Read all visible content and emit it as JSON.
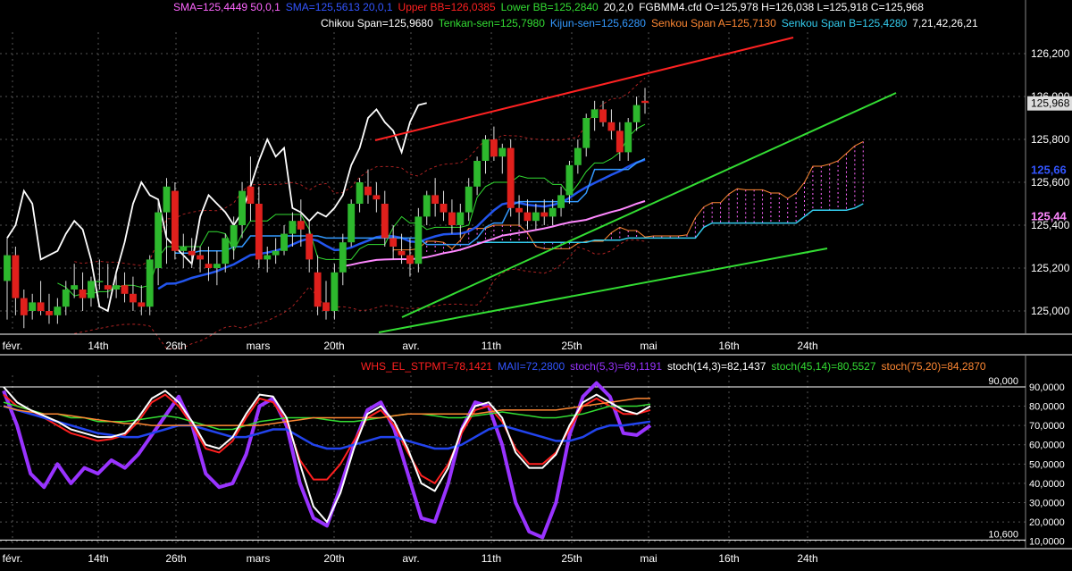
{
  "header": {
    "line1": [
      {
        "text": "SMA=125,4449  50,0,1",
        "color": "#ff66ff"
      },
      {
        "text": "SMA=125,5613  20,0,1",
        "color": "#3355ff"
      },
      {
        "text": "Upper BB=126,0385",
        "color": "#ff2020"
      },
      {
        "text": "Lower BB=125,2840",
        "color": "#33dd33"
      },
      {
        "text": "20,2,0",
        "color": "#ffffff"
      },
      {
        "text": "FGBMM4.cfd O=125,978 H=126,038 L=125,918 C=125,968",
        "color": "#ffffff"
      }
    ],
    "line2": [
      {
        "text": "Chikou Span=125,9680",
        "color": "#ffffff"
      },
      {
        "text": "Tenkan-sen=125,7980",
        "color": "#33dd33"
      },
      {
        "text": "Kijun-sen=125,6280",
        "color": "#3399ff"
      },
      {
        "text": "Senkou Span A=125,7130",
        "color": "#ff8833"
      },
      {
        "text": "Senkou Span B=125,4280",
        "color": "#33ccee"
      },
      {
        "text": "7,21,42,26,21",
        "color": "#ffffff"
      }
    ],
    "osc_line": [
      {
        "text": "WHS_EL_STPMT=78,1421",
        "color": "#ff2020"
      },
      {
        "text": "MAII=72,2800",
        "color": "#3355ff"
      },
      {
        "text": "stoch(5,3)=69,1191",
        "color": "#9933ff"
      },
      {
        "text": "stoch(14,3)=82,1437",
        "color": "#ffffff"
      },
      {
        "text": "stoch(45,14)=80,5527",
        "color": "#33dd33"
      },
      {
        "text": "stoch(75,20)=84,2870",
        "color": "#ff8833"
      }
    ]
  },
  "x_ticks": [
    "févr.",
    "14th",
    "26th",
    "mars",
    "20th",
    "avr.",
    "11th",
    "25th",
    "mai",
    "16th",
    "24th"
  ],
  "price_ticks": [
    "126,200",
    "126,000",
    "125,800",
    "125,600",
    "125,400",
    "125,200",
    "125,000"
  ],
  "price_badges": {
    "last": "125,968",
    "kijun": "125,66",
    "sma": "125,44"
  },
  "osc_ticks": [
    "90,0000",
    "80,0000",
    "70,0000",
    "60,0000",
    "50,0000",
    "40,0000",
    "30,0000",
    "20,0000",
    "10,0000"
  ],
  "osc_levels": {
    "upper": "90,000",
    "lower": "10,600"
  },
  "colors": {
    "up": "#2db82d",
    "down": "#e0201c",
    "sma50": "#ff88ff",
    "sma20": "#2255ee",
    "bb": "#ff2020",
    "tenkan": "#33dd33",
    "kijun": "#3399ff",
    "spanA": "#ff8833",
    "spanB": "#33ccee",
    "chikou": "#ffffff"
  },
  "chart_data": [
    {
      "type": "candlestick",
      "title": "FGBMM4.cfd",
      "ylim": [
        124.9,
        126.3
      ],
      "x": [
        "févr.",
        "14th",
        "26th",
        "mars",
        "20th",
        "avr.",
        "11th",
        "25th",
        "mai"
      ],
      "ohlc_approx": [
        [
          125.14,
          125.34,
          124.96,
          125.26
        ],
        [
          125.26,
          125.3,
          124.98,
          125.06
        ],
        [
          125.06,
          125.1,
          124.92,
          124.98
        ],
        [
          125.0,
          125.08,
          124.96,
          125.04
        ],
        [
          125.04,
          125.14,
          124.98,
          125.0
        ],
        [
          125.0,
          125.08,
          124.94,
          124.98
        ],
        [
          124.98,
          125.06,
          124.94,
          125.02
        ],
        [
          125.02,
          125.14,
          124.98,
          125.1
        ],
        [
          125.1,
          125.22,
          125.06,
          125.12
        ],
        [
          125.1,
          125.18,
          125.0,
          125.06
        ],
        [
          125.06,
          125.16,
          125.02,
          125.14
        ],
        [
          125.14,
          125.24,
          125.1,
          125.14
        ],
        [
          125.12,
          125.22,
          125.06,
          125.1
        ],
        [
          125.1,
          125.18,
          125.06,
          125.12
        ],
        [
          125.12,
          125.18,
          125.04,
          125.08
        ],
        [
          125.08,
          125.16,
          125.0,
          125.04
        ],
        [
          125.04,
          125.12,
          124.98,
          125.02
        ],
        [
          125.02,
          125.26,
          124.98,
          125.24
        ],
        [
          125.2,
          125.52,
          125.12,
          125.46
        ],
        [
          125.46,
          125.62,
          125.22,
          125.58
        ],
        [
          125.56,
          125.6,
          125.24,
          125.28
        ],
        [
          125.28,
          125.36,
          125.2,
          125.3
        ],
        [
          125.28,
          125.34,
          125.2,
          125.26
        ],
        [
          125.26,
          125.3,
          125.18,
          125.24
        ],
        [
          125.22,
          125.3,
          125.14,
          125.2
        ],
        [
          125.2,
          125.28,
          125.12,
          125.22
        ],
        [
          125.22,
          125.36,
          125.18,
          125.34
        ],
        [
          125.3,
          125.44,
          125.24,
          125.4
        ],
        [
          125.4,
          125.6,
          125.34,
          125.56
        ],
        [
          125.58,
          125.72,
          125.42,
          125.5
        ],
        [
          125.5,
          125.58,
          125.2,
          125.24
        ],
        [
          125.24,
          125.3,
          125.18,
          125.26
        ],
        [
          125.26,
          125.34,
          125.22,
          125.28
        ],
        [
          125.28,
          125.4,
          125.26,
          125.36
        ],
        [
          125.36,
          125.46,
          125.3,
          125.42
        ],
        [
          125.42,
          125.52,
          125.3,
          125.38
        ],
        [
          125.36,
          125.42,
          125.18,
          125.24
        ],
        [
          125.18,
          125.26,
          124.98,
          125.02
        ],
        [
          125.04,
          125.14,
          124.96,
          125.0
        ],
        [
          125.0,
          125.22,
          124.96,
          125.18
        ],
        [
          125.18,
          125.36,
          125.12,
          125.32
        ],
        [
          125.32,
          125.52,
          125.3,
          125.5
        ],
        [
          125.5,
          125.62,
          125.46,
          125.6
        ],
        [
          125.58,
          125.66,
          125.5,
          125.54
        ],
        [
          125.54,
          125.6,
          125.46,
          125.52
        ],
        [
          125.5,
          125.56,
          125.3,
          125.34
        ],
        [
          125.34,
          125.4,
          125.24,
          125.3
        ],
        [
          125.28,
          125.36,
          125.22,
          125.26
        ],
        [
          125.26,
          125.34,
          125.16,
          125.22
        ],
        [
          125.22,
          125.48,
          125.18,
          125.44
        ],
        [
          125.44,
          125.56,
          125.4,
          125.54
        ],
        [
          125.54,
          125.62,
          125.44,
          125.5
        ],
        [
          125.5,
          125.56,
          125.42,
          125.46
        ],
        [
          125.46,
          125.52,
          125.36,
          125.4
        ],
        [
          125.4,
          125.5,
          125.34,
          125.46
        ],
        [
          125.46,
          125.62,
          125.42,
          125.58
        ],
        [
          125.58,
          125.72,
          125.54,
          125.7
        ],
        [
          125.7,
          125.82,
          125.64,
          125.8
        ],
        [
          125.8,
          125.86,
          125.7,
          125.72
        ],
        [
          125.72,
          125.78,
          125.64,
          125.76
        ],
        [
          125.76,
          125.8,
          125.44,
          125.48
        ],
        [
          125.48,
          125.54,
          125.4,
          125.46
        ],
        [
          125.46,
          125.52,
          125.38,
          125.42
        ],
        [
          125.42,
          125.5,
          125.38,
          125.46
        ],
        [
          125.46,
          125.52,
          125.4,
          125.44
        ],
        [
          125.44,
          125.52,
          125.4,
          125.48
        ],
        [
          125.48,
          125.58,
          125.44,
          125.54
        ],
        [
          125.54,
          125.7,
          125.5,
          125.68
        ],
        [
          125.68,
          125.8,
          125.64,
          125.76
        ],
        [
          125.76,
          125.92,
          125.72,
          125.9
        ],
        [
          125.9,
          125.98,
          125.84,
          125.94
        ],
        [
          125.94,
          125.98,
          125.86,
          125.88
        ],
        [
          125.88,
          125.94,
          125.8,
          125.84
        ],
        [
          125.84,
          125.88,
          125.7,
          125.74
        ],
        [
          125.74,
          125.9,
          125.7,
          125.88
        ],
        [
          125.88,
          126.0,
          125.84,
          125.96
        ],
        [
          125.98,
          126.04,
          125.92,
          125.97
        ]
      ]
    },
    {
      "type": "line",
      "ylim": [
        8,
        96
      ],
      "x": [
        "févr.",
        "14th",
        "26th",
        "mars",
        "20th",
        "avr.",
        "11th",
        "25th",
        "mai"
      ],
      "series": [
        {
          "name": "stoch(5,3)",
          "values": [
            88,
            70,
            45,
            38,
            50,
            40,
            48,
            45,
            52,
            48,
            55,
            65,
            75,
            85,
            70,
            45,
            38,
            40,
            55,
            80,
            84,
            70,
            40,
            22,
            18,
            38,
            60,
            78,
            82,
            68,
            45,
            22,
            20,
            40,
            68,
            82,
            80,
            60,
            30,
            15,
            12,
            30,
            65,
            85,
            92,
            85,
            66,
            65,
            70
          ]
        },
        {
          "name": "stoch(14,3)",
          "values": [
            90,
            82,
            78,
            75,
            72,
            68,
            66,
            64,
            64,
            66,
            74,
            84,
            88,
            82,
            72,
            60,
            58,
            64,
            76,
            86,
            85,
            74,
            50,
            28,
            20,
            35,
            58,
            76,
            80,
            72,
            58,
            40,
            36,
            48,
            68,
            80,
            82,
            74,
            56,
            48,
            48,
            55,
            70,
            82,
            86,
            82,
            78,
            76,
            80
          ]
        },
        {
          "name": "WHS_EL_STPMT",
          "values": [
            86,
            80,
            78,
            74,
            70,
            66,
            64,
            62,
            63,
            65,
            72,
            82,
            86,
            80,
            70,
            58,
            56,
            62,
            74,
            84,
            82,
            72,
            52,
            42,
            42,
            50,
            62,
            74,
            78,
            70,
            56,
            44,
            40,
            50,
            66,
            78,
            80,
            72,
            58,
            50,
            50,
            56,
            68,
            80,
            84,
            80,
            76,
            76,
            78
          ]
        },
        {
          "name": "MAII",
          "values": [
            80,
            78,
            76,
            74,
            72,
            70,
            68,
            66,
            65,
            64,
            64,
            66,
            68,
            70,
            70,
            68,
            66,
            64,
            64,
            66,
            68,
            68,
            64,
            60,
            58,
            58,
            60,
            62,
            64,
            64,
            62,
            60,
            58,
            58,
            60,
            64,
            68,
            70,
            68,
            66,
            64,
            62,
            62,
            64,
            68,
            70,
            70,
            71,
            72
          ]
        },
        {
          "name": "stoch(45,14)",
          "values": [
            82,
            80,
            78,
            76,
            76,
            74,
            74,
            72,
            72,
            72,
            73,
            74,
            75,
            74,
            72,
            70,
            68,
            68,
            70,
            72,
            73,
            74,
            74,
            74,
            73,
            72,
            72,
            73,
            74,
            75,
            76,
            76,
            75,
            74,
            74,
            75,
            76,
            77,
            76,
            75,
            74,
            74,
            75,
            76,
            78,
            80,
            80,
            80,
            81
          ]
        },
        {
          "name": "stoch(75,20)",
          "values": [
            80,
            78,
            77,
            76,
            76,
            75,
            74,
            73,
            72,
            71,
            71,
            70,
            70,
            70,
            70,
            70,
            70,
            70,
            70,
            70,
            71,
            72,
            73,
            74,
            74,
            74,
            74,
            74,
            74,
            75,
            76,
            76,
            76,
            76,
            76,
            76,
            77,
            78,
            78,
            78,
            78,
            78,
            79,
            80,
            81,
            82,
            83,
            84,
            84
          ]
        }
      ]
    }
  ]
}
